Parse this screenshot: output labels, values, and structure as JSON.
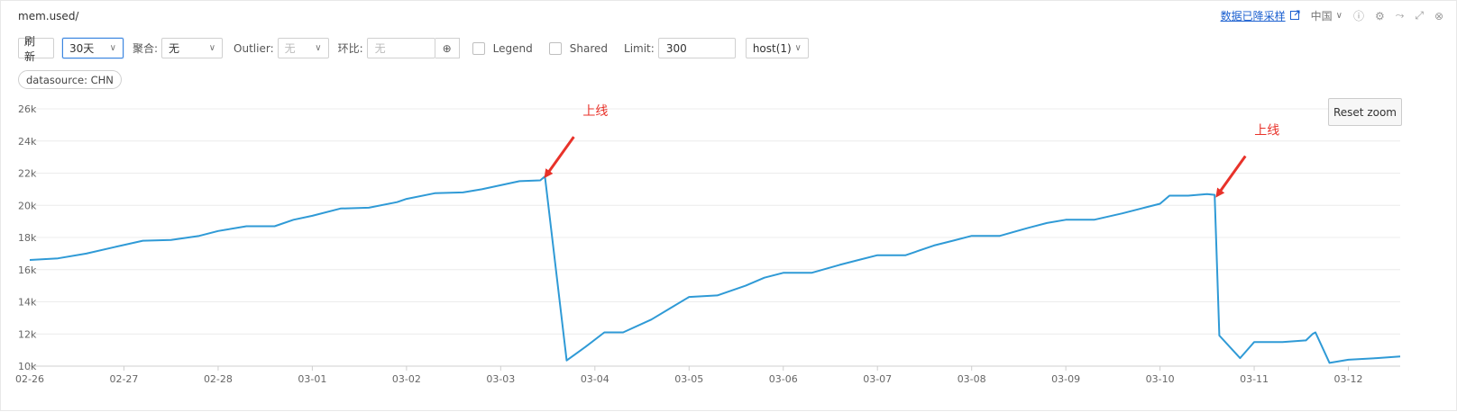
{
  "header": {
    "title": "mem.used/",
    "downsample_link": "数据已降采样",
    "region": "中国"
  },
  "toolbar": {
    "refresh": "刷 新",
    "range": "30天",
    "agg_label": "聚合:",
    "agg_value": "无",
    "outlier_label": "Outlier:",
    "outlier_value": "无",
    "compare_label": "环比:",
    "compare_placeholder": "无",
    "legend_label": "Legend",
    "shared_label": "Shared",
    "limit_label": "Limit:",
    "limit_value": "300",
    "host_select": "host(1)"
  },
  "tags": {
    "datasource": "datasource: CHN"
  },
  "reset_zoom": "Reset zoom",
  "colors": {
    "line": "#2f9ad6",
    "annotation": "#e8322a",
    "link": "#1a5fd0"
  },
  "chart_data": {
    "type": "line",
    "title": "",
    "xlabel": "",
    "ylabel": "",
    "ylim": [
      10000,
      26000
    ],
    "y_ticks": [
      "10k",
      "12k",
      "14k",
      "16k",
      "18k",
      "20k",
      "22k",
      "24k",
      "26k"
    ],
    "y_tick_values": [
      10000,
      12000,
      14000,
      16000,
      18000,
      20000,
      22000,
      24000,
      26000
    ],
    "x_ticks": [
      "02-26",
      "02-27",
      "02-28",
      "03-01",
      "03-02",
      "03-03",
      "03-04",
      "03-05",
      "03-06",
      "03-07",
      "03-08",
      "03-09",
      "03-10",
      "03-11",
      "03-12"
    ],
    "x_tick_values": [
      0,
      1,
      2,
      3,
      4,
      5,
      6,
      7,
      8,
      9,
      10,
      11,
      12,
      13,
      14
    ],
    "xlim": [
      0,
      14.55
    ],
    "grid": true,
    "legend": false,
    "series": [
      {
        "x": [
          0,
          0.3,
          0.6,
          0.9,
          1.2,
          1.5,
          1.8,
          2.0,
          2.3,
          2.6,
          2.8,
          3.0,
          3.3,
          3.6,
          3.9,
          4.0,
          4.3,
          4.6,
          4.8,
          5.0,
          5.2,
          5.42,
          5.47,
          5.7,
          5.9,
          6.1,
          6.3,
          6.6,
          6.8,
          7.0,
          7.3,
          7.6,
          7.8,
          8.0,
          8.3,
          8.6,
          8.8,
          9.0,
          9.3,
          9.6,
          9.8,
          10.0,
          10.3,
          10.6,
          10.8,
          11.0,
          11.3,
          11.6,
          11.8,
          12.0,
          12.1,
          12.3,
          12.5,
          12.58,
          12.63,
          12.85,
          13.0,
          13.3,
          13.55,
          13.62,
          13.65,
          13.8,
          14.0,
          14.3,
          14.55
        ],
        "y": [
          16600,
          16700,
          17000,
          17400,
          17800,
          17850,
          18100,
          18400,
          18700,
          18700,
          19100,
          19350,
          19800,
          19850,
          20200,
          20400,
          20750,
          20800,
          21000,
          21250,
          21500,
          21550,
          21800,
          10350,
          11200,
          12100,
          12100,
          12900,
          13600,
          14300,
          14400,
          15000,
          15500,
          15800,
          15800,
          16300,
          16600,
          16900,
          16900,
          17500,
          17800,
          18100,
          18100,
          18600,
          18900,
          19100,
          19100,
          19500,
          19800,
          20100,
          20600,
          20600,
          20700,
          20650,
          11900,
          10500,
          11500,
          11500,
          11600,
          12000,
          12100,
          10200,
          10400,
          10500,
          10600
        ]
      }
    ],
    "annotations": [
      {
        "text": "上线",
        "x": 5.47,
        "y": 21800
      },
      {
        "text": "上线",
        "x": 12.6,
        "y": 20600
      }
    ]
  }
}
